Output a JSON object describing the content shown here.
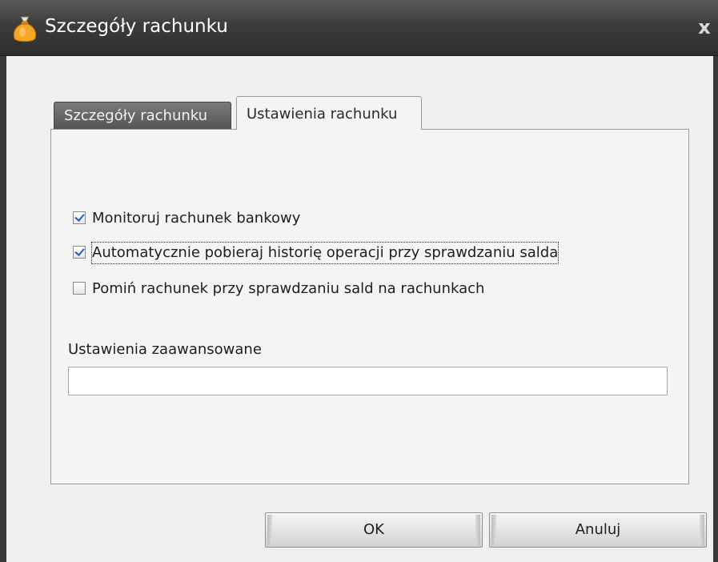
{
  "window": {
    "title": "Szczegóły rachunku",
    "icon": "money-bag-icon",
    "close_glyph": "x"
  },
  "tabs": [
    {
      "label": "Szczegóły rachunku",
      "active": false
    },
    {
      "label": "Ustawienia rachunku",
      "active": true
    }
  ],
  "settings": {
    "checkboxes": [
      {
        "label": "Monitoruj rachunek bankowy",
        "checked": true
      },
      {
        "label": "Automatycznie pobieraj historię operacji przy sprawdzaniu salda",
        "checked": true,
        "focused": true
      },
      {
        "label": "Pomiń rachunek przy sprawdzaniu sald na rachunkach",
        "checked": false
      }
    ],
    "advanced_label": "Ustawienia zaawansowane",
    "advanced_value": ""
  },
  "buttons": {
    "ok_label": "OK",
    "cancel_label": "Anuluj"
  },
  "colors": {
    "titlebar": "#3c3c3c",
    "check_mark": "#1f5fbf",
    "icon_bag": "#f5a623"
  }
}
